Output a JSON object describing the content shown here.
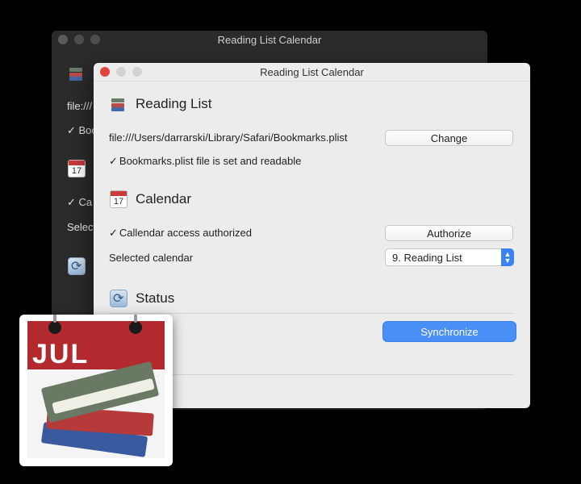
{
  "back_window": {
    "title": "Reading List Calendar",
    "fragments": [
      "file:///",
      "✓ Boo",
      "✓ Ca",
      "Select"
    ]
  },
  "window": {
    "title": "Reading List Calendar",
    "reading_list": {
      "title": "Reading List",
      "path": "file:///Users/darrarski/Library/Safari/Bookmarks.plist",
      "change_label": "Change",
      "status_text": "Bookmarks.plist file is set and readable"
    },
    "calendar": {
      "title": "Calendar",
      "icon_day": "17",
      "status_text": "Callendar access authorized",
      "authorize_label": "Authorize",
      "selected_label": "Selected calendar",
      "selected_value": "9. Reading List"
    },
    "status": {
      "title": "Status",
      "synchronize_label": "Synchronize"
    }
  },
  "app_icon": {
    "month": "JUL"
  },
  "colors": {
    "accent": "#4a8ff5",
    "close": "#e0443e",
    "calendar_red": "#b2292e"
  }
}
